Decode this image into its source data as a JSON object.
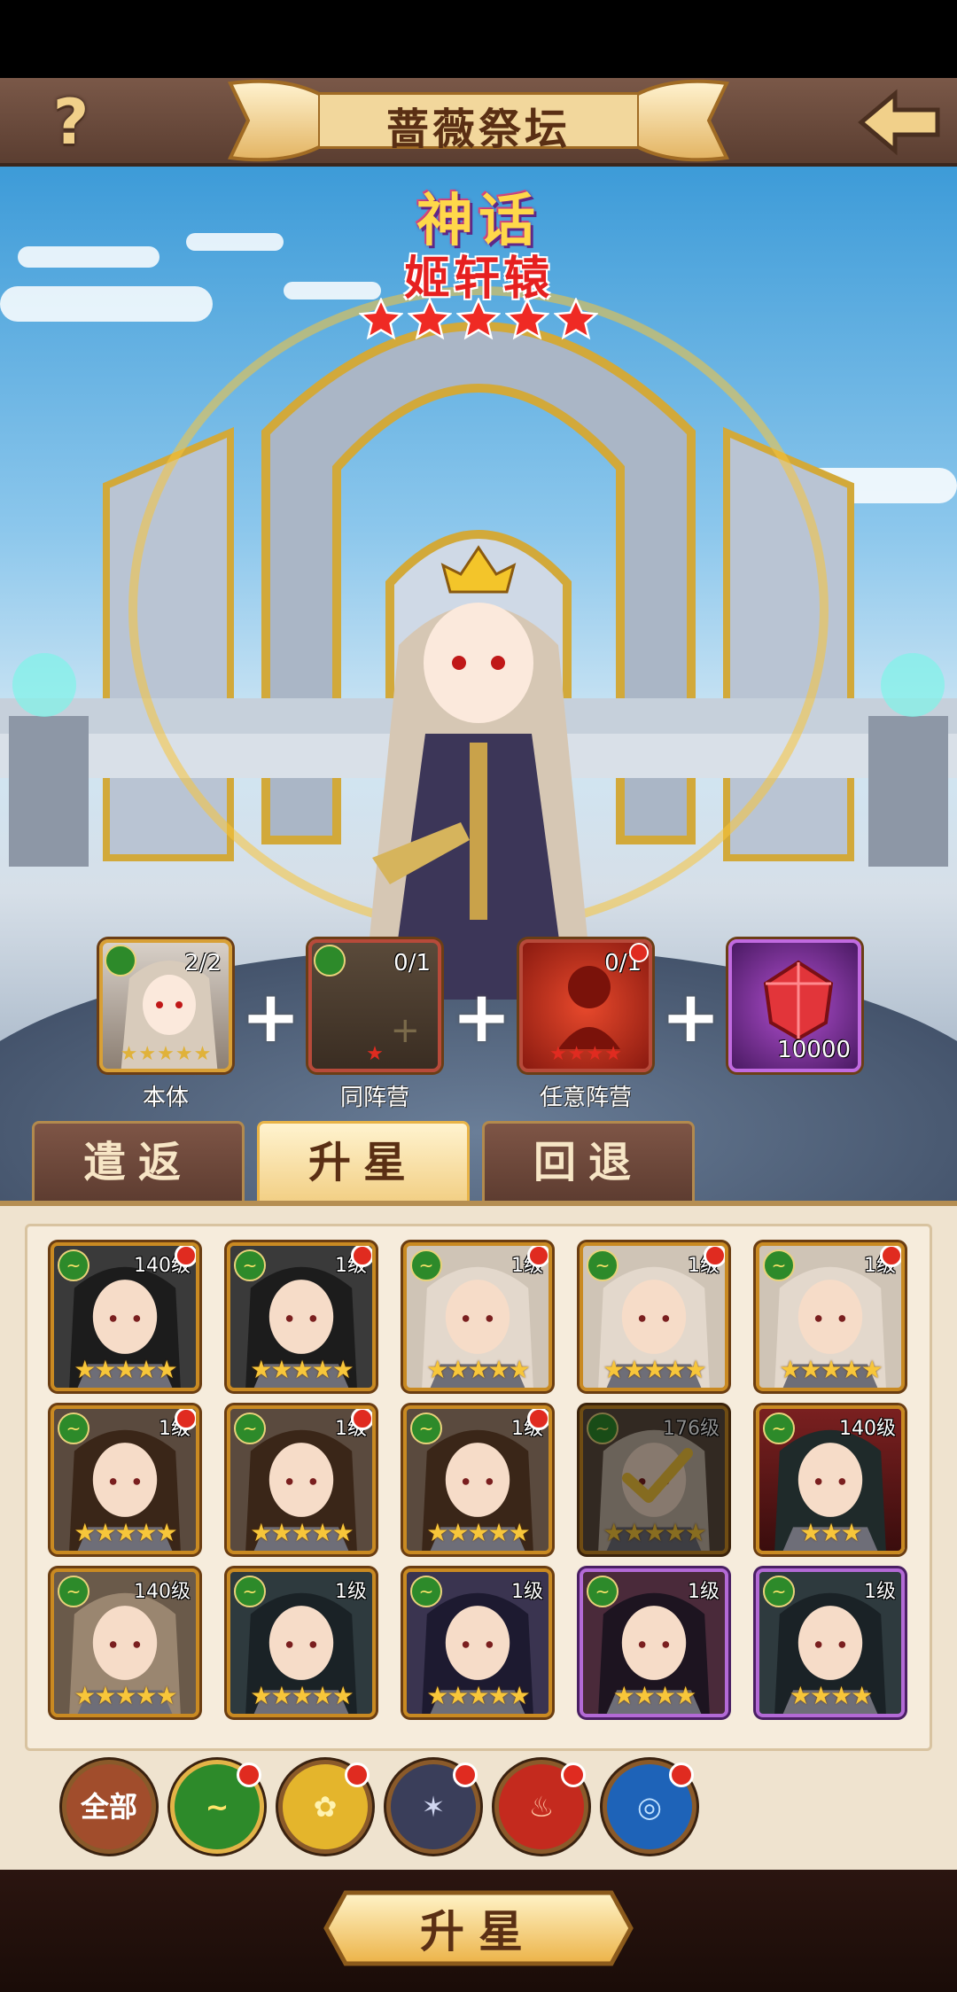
{
  "header": {
    "title": "蔷薇祭坛",
    "help_label": "?"
  },
  "hero": {
    "rarity": "神话",
    "name": "姬轩辕",
    "stars": 5
  },
  "materials": [
    {
      "label": "本体",
      "count": "2/2"
    },
    {
      "label": "同阵营",
      "count": "0/1"
    },
    {
      "label": "任意阵营",
      "count": "0/1"
    },
    {
      "label": "",
      "count": "10000"
    }
  ],
  "tabs": [
    {
      "label": "遣返"
    },
    {
      "label": "升星"
    },
    {
      "label": "回退"
    }
  ],
  "cards": [
    {
      "level": "140级"
    },
    {
      "level": "1级"
    },
    {
      "level": "1级"
    },
    {
      "level": "1级"
    },
    {
      "level": "1级"
    },
    {
      "level": "1级"
    },
    {
      "level": "1级"
    },
    {
      "level": "1级"
    },
    {
      "level": "176级"
    },
    {
      "level": "140级"
    },
    {
      "level": "140级"
    },
    {
      "level": "1级"
    },
    {
      "level": "1级"
    },
    {
      "level": "1级"
    },
    {
      "level": "1级"
    }
  ],
  "filters": {
    "all_label": "全部"
  },
  "action": {
    "star_up_label": "升星"
  },
  "colors": {
    "panel_bg": "#efe3cf",
    "header_bg": "#5b3e31",
    "accent_gold": "#e8b347",
    "badge_red": "#e02b20"
  }
}
